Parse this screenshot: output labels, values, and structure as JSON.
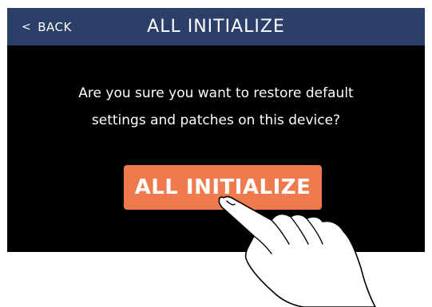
{
  "header": {
    "back_icon": "‹",
    "back_label": "BACK",
    "title": "ALL INITIALIZE"
  },
  "dialog": {
    "message_line1": "Are you sure you want to restore default",
    "message_line2": "settings and patches on this device?",
    "confirm_label": "ALL INITIALIZE"
  },
  "colors": {
    "header_bg": "#2b3f68",
    "screen_bg": "#000000",
    "button_bg": "#ee7a4e",
    "text": "#ffffff"
  },
  "icons": {
    "back": "chevron-left-icon",
    "pointer": "tapping-hand-icon"
  }
}
